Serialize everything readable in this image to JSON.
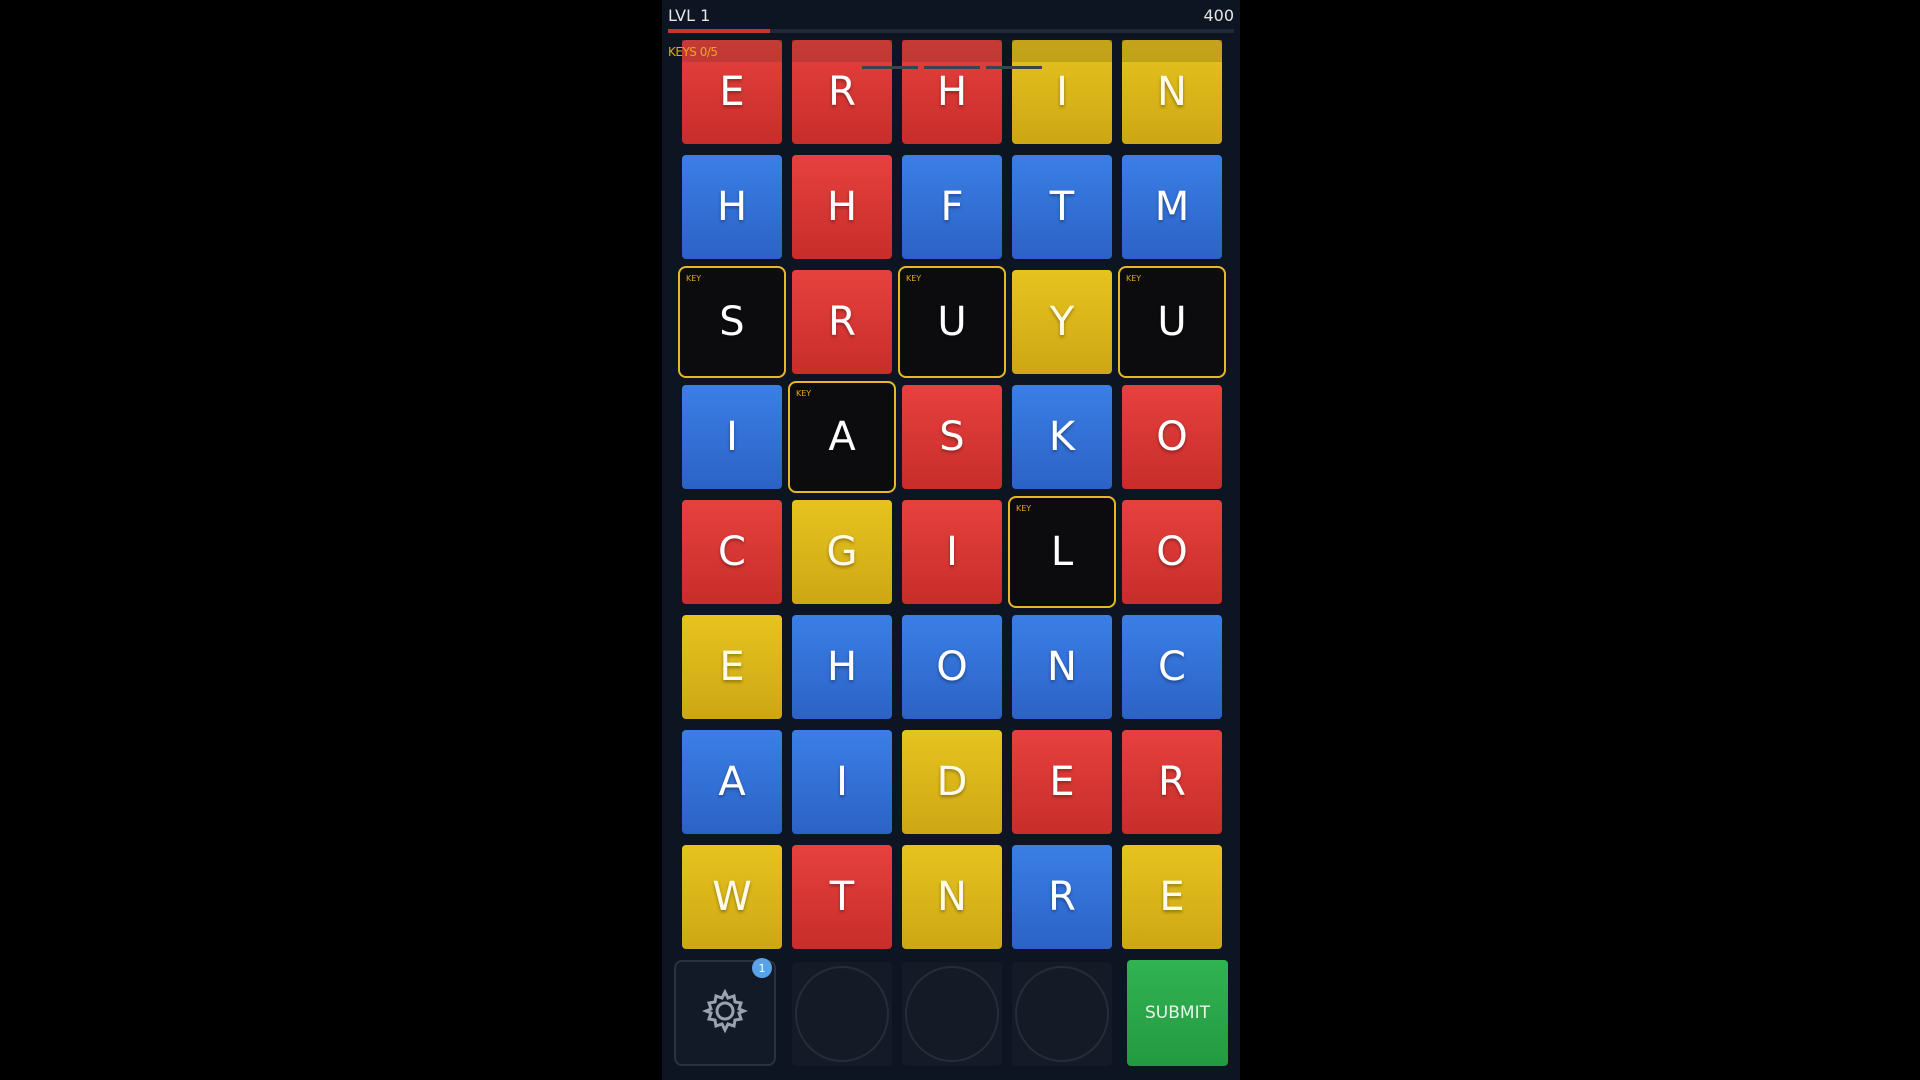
{
  "header": {
    "level_label": "LVL 1",
    "score": "400",
    "progress_fraction": 0.18,
    "keys_label": "KEYS 0/5"
  },
  "colors": {
    "red": "#e7413e",
    "blue": "#3a7fe6",
    "yellow": "#e7c31f",
    "key_tile": "#0c0c0e",
    "key_border": "#e6b827",
    "submit": "#31b352",
    "background": "#0d1422"
  },
  "drop_indicators": [
    "red",
    "red",
    "red",
    "yellow",
    "yellow"
  ],
  "grid": {
    "rows": [
      [
        {
          "letter": "E",
          "color": "red"
        },
        {
          "letter": "R",
          "color": "red"
        },
        {
          "letter": "H",
          "color": "red"
        },
        {
          "letter": "I",
          "color": "yellow"
        },
        {
          "letter": "N",
          "color": "yellow"
        }
      ],
      [
        {
          "letter": "H",
          "color": "blue"
        },
        {
          "letter": "H",
          "color": "red"
        },
        {
          "letter": "F",
          "color": "blue"
        },
        {
          "letter": "T",
          "color": "blue"
        },
        {
          "letter": "M",
          "color": "blue"
        }
      ],
      [
        {
          "letter": "S",
          "color": "black",
          "key": true
        },
        {
          "letter": "R",
          "color": "red"
        },
        {
          "letter": "U",
          "color": "black",
          "key": true
        },
        {
          "letter": "Y",
          "color": "yellow"
        },
        {
          "letter": "U",
          "color": "black",
          "key": true
        }
      ],
      [
        {
          "letter": "I",
          "color": "blue"
        },
        {
          "letter": "A",
          "color": "black",
          "key": true
        },
        {
          "letter": "S",
          "color": "red"
        },
        {
          "letter": "K",
          "color": "blue"
        },
        {
          "letter": "O",
          "color": "red"
        }
      ],
      [
        {
          "letter": "C",
          "color": "red"
        },
        {
          "letter": "G",
          "color": "yellow"
        },
        {
          "letter": "I",
          "color": "red"
        },
        {
          "letter": "L",
          "color": "black",
          "key": true
        },
        {
          "letter": "O",
          "color": "red"
        }
      ],
      [
        {
          "letter": "E",
          "color": "yellow"
        },
        {
          "letter": "H",
          "color": "blue"
        },
        {
          "letter": "O",
          "color": "blue"
        },
        {
          "letter": "N",
          "color": "blue"
        },
        {
          "letter": "C",
          "color": "blue"
        }
      ],
      [
        {
          "letter": "A",
          "color": "blue"
        },
        {
          "letter": "I",
          "color": "blue"
        },
        {
          "letter": "D",
          "color": "yellow"
        },
        {
          "letter": "E",
          "color": "red"
        },
        {
          "letter": "R",
          "color": "red"
        }
      ],
      [
        {
          "letter": "W",
          "color": "yellow"
        },
        {
          "letter": "T",
          "color": "red"
        },
        {
          "letter": "N",
          "color": "yellow"
        },
        {
          "letter": "R",
          "color": "blue"
        },
        {
          "letter": "E",
          "color": "yellow"
        }
      ]
    ],
    "key_tag_label": "KEY"
  },
  "bottom": {
    "settings_icon": "gear-icon",
    "settings_badge": "1",
    "slots": 3,
    "submit_label": "SUBMIT"
  }
}
